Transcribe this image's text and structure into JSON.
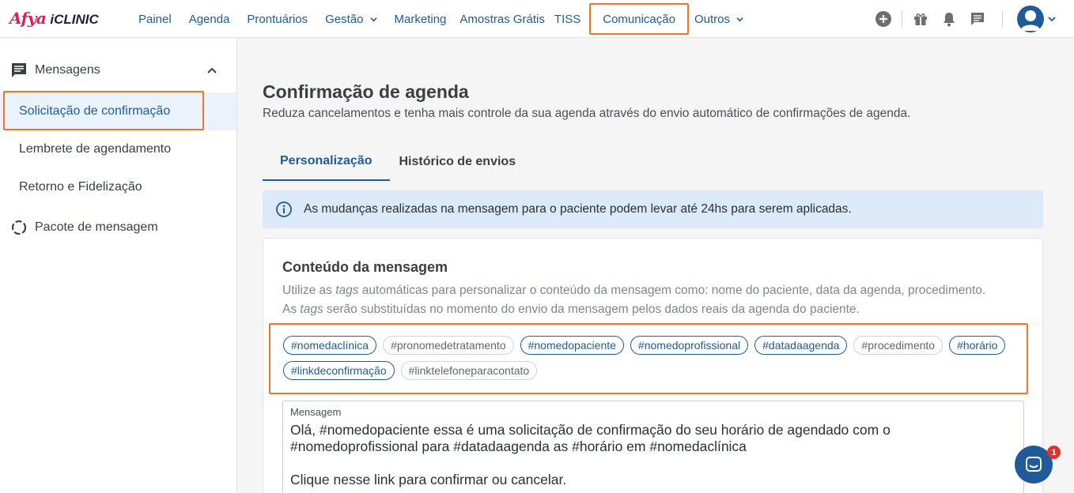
{
  "brand": {
    "afya": "Afya",
    "iclinic": "iCLINIC"
  },
  "nav": {
    "items": [
      {
        "label": "Painel"
      },
      {
        "label": "Agenda"
      },
      {
        "label": "Prontuários"
      },
      {
        "label": "Gestão"
      },
      {
        "label": "Marketing"
      },
      {
        "label": "Amostras Grátis"
      },
      {
        "label": "TISS"
      },
      {
        "label": "Comunicação"
      },
      {
        "label": "Outros"
      }
    ]
  },
  "top_icons": [
    "plus-circle-icon",
    "gift-icon",
    "bell-icon",
    "chat-icon",
    "avatar-icon",
    "chevron-down-icon"
  ],
  "sidebar": {
    "group_label": "Mensagens",
    "items": [
      {
        "label": "Solicitação de confirmação"
      },
      {
        "label": "Lembrete de agendamento"
      },
      {
        "label": "Retorno e Fidelização"
      }
    ],
    "package_label": "Pacote de mensagem"
  },
  "main": {
    "title": "Confirmação de agenda",
    "subtitle": "Reduza cancelamentos e tenha mais controle da sua agenda através do envio automático de confirmações de agenda.",
    "tabs": [
      {
        "label": "Personalização"
      },
      {
        "label": "Histórico de envios"
      }
    ],
    "alert": "As mudanças realizadas na mensagem para o paciente podem levar até 24hs para serem aplicadas.",
    "card": {
      "title": "Conteúdo da mensagem",
      "desc_1_a": "Utilize as ",
      "desc_1_tag": "tags",
      "desc_1_b": " automáticas para personalizar o conteúdo da mensagem como: nome do paciente, data da agenda, procedimento.",
      "desc_2_a": "As ",
      "desc_2_tag": "tags",
      "desc_2_b": " serão substituídas no momento do envio da mensagem pelos dados reais da agenda do paciente.",
      "tags": [
        {
          "label": "#nomedaclínica"
        },
        {
          "label": "#pronomedetratamento"
        },
        {
          "label": "#nomedopaciente"
        },
        {
          "label": "#nomedoprofissional"
        },
        {
          "label": "#datadaagenda"
        },
        {
          "label": "#procedimento"
        },
        {
          "label": "#horário"
        },
        {
          "label": "#linkdeconfirmação"
        },
        {
          "label": "#linktelefoneparacontato"
        }
      ],
      "message_label": "Mensagem",
      "message_text": "Olá, #nomedopaciente essa é uma solicitação de confirmação do seu horário de agendado com o #nomedoprofissional para #datadaagenda as #horário em #nomedaclínica\n\nClique nesse link para confirmar ou cancelar."
    }
  },
  "chat": {
    "badge": "1"
  },
  "colors": {
    "brand_pink": "#d5215a",
    "primary": "#1f5b99",
    "highlight": "#f07522",
    "alert_bg": "#dbe9f8"
  }
}
